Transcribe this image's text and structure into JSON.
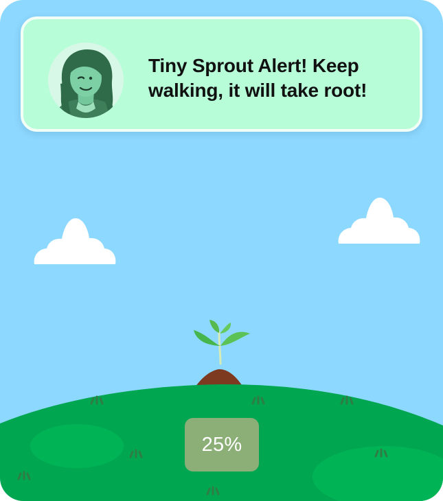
{
  "notification": {
    "message": "Tiny Sprout Alert! Keep walking, it will take root!"
  },
  "progress": {
    "label": "25%",
    "value_percent": 25
  },
  "icons": {
    "avatar": "woman-avatar-icon",
    "plant": "sprout-icon",
    "clouds": "cloud-icon"
  },
  "colors": {
    "sky": "#8dd8ff",
    "notification_background": "#b6fdd8",
    "hill": "#00a650",
    "progress_badge": "#8caf78"
  }
}
